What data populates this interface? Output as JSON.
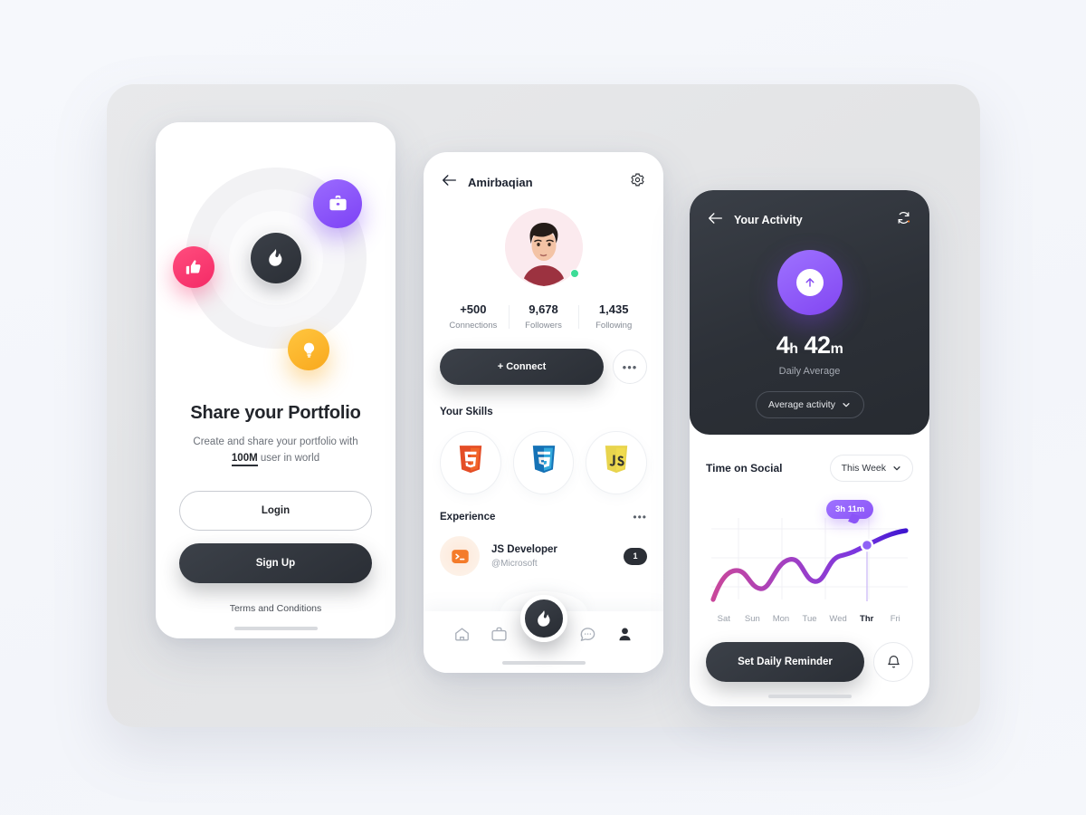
{
  "theme": {
    "page_bg": "#f4f6fb",
    "tray_bg": "#e4e5e7",
    "dark": "#2b2f36",
    "purple": "#8246f2",
    "pink": "#f42a66",
    "amber": "#f9a81d",
    "green": "#3ddc97",
    "orange": "#f47b2a"
  },
  "onboarding": {
    "icons": {
      "center": "flame-icon",
      "like": "thumbs-up-icon",
      "work": "briefcase-icon",
      "idea": "lightbulb-icon"
    },
    "title": "Share your Portfolio",
    "subtitle_pre": "Create and share your portfolio with",
    "subtitle_highlight": "100M",
    "subtitle_post": "user in world",
    "login_label": "Login",
    "signup_label": "Sign Up",
    "terms_label": "Terms and Conditions"
  },
  "profile": {
    "back_icon": "arrow-left-icon",
    "name": "Amirbaqian",
    "settings_icon": "gear-icon",
    "status": "online",
    "stats": [
      {
        "value": "+500",
        "label": "Connections"
      },
      {
        "value": "9,678",
        "label": "Followers"
      },
      {
        "value": "1,435",
        "label": "Following"
      }
    ],
    "connect_label": "+ Connect",
    "more_label": "•••",
    "skills_title": "Your Skills",
    "skills": [
      {
        "name": "html5-icon",
        "label": "HTML5"
      },
      {
        "name": "css3-icon",
        "label": "CSS3"
      },
      {
        "name": "javascript-icon",
        "label": "JS"
      }
    ],
    "experience_title": "Experience",
    "experience_more": "•••",
    "experience": [
      {
        "icon": "terminal-icon",
        "role": "JS Developer",
        "org": "@Microsoft",
        "badge": "1"
      }
    ],
    "nav": [
      {
        "name": "home-icon",
        "label": "Home",
        "active": false
      },
      {
        "name": "briefcase-icon",
        "label": "Jobs",
        "active": false
      },
      {
        "name": "chat-icon",
        "label": "Messages",
        "active": false
      },
      {
        "name": "person-icon",
        "label": "Profile",
        "active": true
      }
    ],
    "fab_icon": "flame-icon"
  },
  "activity": {
    "back_icon": "arrow-left-icon",
    "title": "Your Activity",
    "refresh_icon": "refresh-icon",
    "ring_icon": "arrow-up-icon",
    "time_hours": "4",
    "time_hours_unit": "h",
    "time_minutes": "42",
    "time_minutes_unit": "m",
    "time_caption": "Daily Average",
    "filter_label": "Average activity",
    "filter_chevron": "chevron-down-icon",
    "chart_title": "Time on Social",
    "range_label": "This Week",
    "range_chevron": "chevron-down-icon",
    "tooltip_value": "3h 11m",
    "reminder_label": "Set Daily Reminder",
    "bell_icon": "bell-icon"
  },
  "chart_data": {
    "type": "line",
    "title": "Time on Social",
    "xlabel": "",
    "ylabel": "",
    "categories": [
      "Sat",
      "Sun",
      "Mon",
      "Tue",
      "Wed",
      "Thr",
      "Fri"
    ],
    "values": [
      0.4,
      1.6,
      0.9,
      2.5,
      1.5,
      3.18,
      3.9
    ],
    "highlighted_category": "Thr",
    "highlighted_value_label": "3h 11m",
    "ylim": [
      0,
      4.4
    ],
    "grid": true,
    "legend": "none",
    "stroke_gradient": [
      "#c9479b",
      "#8b3fd6",
      "#4c1fd7"
    ]
  }
}
